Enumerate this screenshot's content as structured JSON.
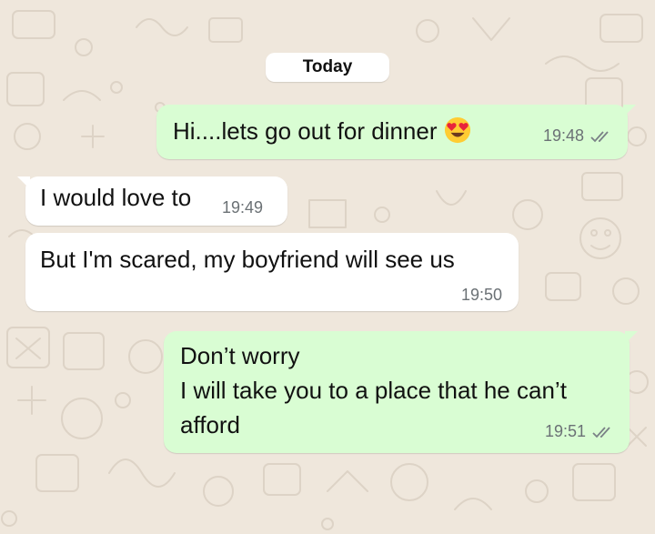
{
  "chat": {
    "date_divider": "Today",
    "messages": [
      {
        "direction": "outgoing",
        "text": "Hi....lets go out for dinner",
        "emoji": "heart-eyes-emoji",
        "time": "19:48",
        "status": "read"
      },
      {
        "direction": "incoming",
        "text": "I would love to",
        "time": "19:49"
      },
      {
        "direction": "incoming",
        "text": "But I'm scared, my boyfriend will see us",
        "time": "19:50"
      },
      {
        "direction": "outgoing",
        "lines": [
          "Don’t worry",
          "I will take you to a place that he can’t",
          "afford"
        ],
        "time": "19:51",
        "status": "read"
      }
    ]
  },
  "colors": {
    "wallpaper": "#efe7dc",
    "outgoing_bubble": "#d9fdd3",
    "incoming_bubble": "#ffffff",
    "meta_text": "#6b7175"
  }
}
